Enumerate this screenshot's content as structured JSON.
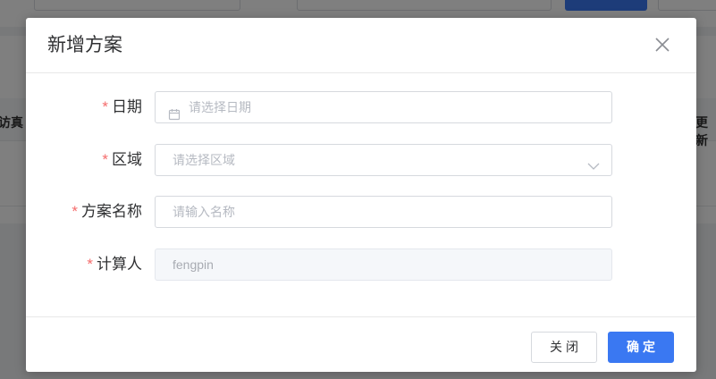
{
  "background": {
    "header_left": "访真",
    "header_right": "更新"
  },
  "dialog": {
    "title": "新增方案",
    "close_icon": "close-icon",
    "fields": [
      {
        "label": "日期",
        "required": "*",
        "placeholder": "请选择日期",
        "icon": "calendar-icon"
      },
      {
        "label": "区域",
        "required": "*",
        "placeholder": "请选择区域",
        "icon": "chevron-down-icon"
      },
      {
        "label": "方案名称",
        "required": "*",
        "placeholder": "请输入名称"
      },
      {
        "label": "计算人",
        "required": "*",
        "value": "fengpin",
        "disabled": true
      }
    ],
    "footer": {
      "cancel_label": "关闭",
      "confirm_label": "确定"
    }
  },
  "colors": {
    "primary": "#3a78f2",
    "required": "#f56c6c",
    "overlay": "rgba(0,0,0,0.5)"
  }
}
